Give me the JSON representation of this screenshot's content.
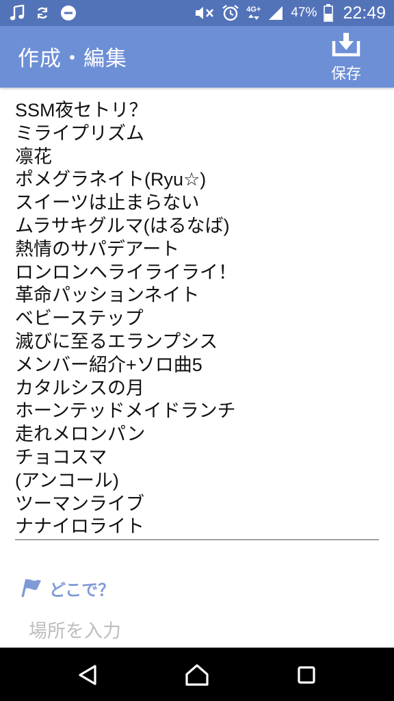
{
  "status_bar": {
    "left_icons": [
      "music-note-icon",
      "sync-icon",
      "do-not-disturb-icon"
    ],
    "network_type": "4G+",
    "battery_percent": "47%",
    "time": "22:49"
  },
  "app_bar": {
    "title": "作成・編集",
    "save_label": "保存"
  },
  "setlist_lines": [
    "SSM夜セトリ？",
    "ミライプリズム",
    "凛花",
    "ポメグラネイト(Ryu☆)",
    "スイーツは止まらない",
    "ムラサキグルマ(はるなば)",
    "熱情のサパデアート",
    "ロンロンヘライライライ！",
    "革命パッションネイト",
    "ベビーステップ",
    "滅びに至るエランプシス",
    "メンバー紹介+ソロ曲5",
    "カタルシスの月",
    "ホーンテッドメイドランチ",
    "走れメロンパン",
    "チョコスマ",
    "(アンコール)",
    "ツーマンライブ",
    "ナナイロライト"
  ],
  "location": {
    "label": "どこで？",
    "placeholder": "場所を入力"
  },
  "colors": {
    "status_bar": "#5373b9",
    "app_bar": "#6d8fd6",
    "accent": "#7f9bd6"
  }
}
